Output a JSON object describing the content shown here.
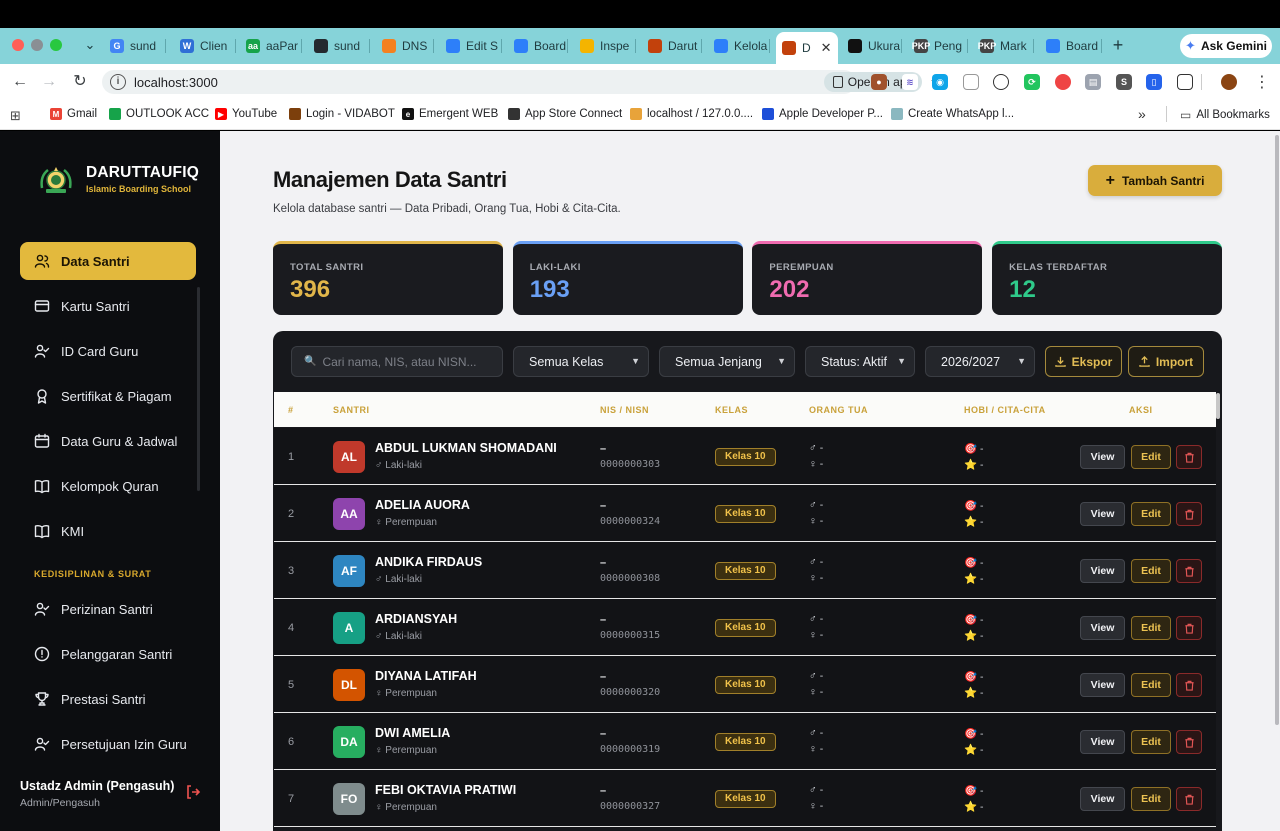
{
  "browser": {
    "tabs": [
      {
        "label": "sund",
        "fav": "G",
        "color": "#4285f4"
      },
      {
        "label": "Clien",
        "fav": "W",
        "color": "#2f6fd6"
      },
      {
        "label": "aaPar",
        "fav": "aa",
        "color": "#16a34a"
      },
      {
        "label": "sund",
        "fav": "",
        "color": "#24292f"
      },
      {
        "label": "DNS",
        "fav": "",
        "color": "#f48120"
      },
      {
        "label": "Edit S",
        "fav": "",
        "color": "#2d7ff9"
      },
      {
        "label": "Board",
        "fav": "",
        "color": "#2d7ff9"
      },
      {
        "label": "Inspe",
        "fav": "",
        "color": "#f4b400"
      },
      {
        "label": "Darut",
        "fav": "",
        "color": "#c2410c"
      },
      {
        "label": "Kelola",
        "fav": "",
        "color": "#2d7ff9"
      },
      {
        "label": "D",
        "fav": "",
        "color": "#c2410c",
        "active": true
      },
      {
        "label": "Ukura",
        "fav": "",
        "color": "#111111"
      },
      {
        "label": "Peng",
        "fav": "PKP",
        "color": "#444444"
      },
      {
        "label": "Mark",
        "fav": "PKP",
        "color": "#444444"
      },
      {
        "label": "Board",
        "fav": "",
        "color": "#2d7ff9"
      }
    ],
    "gemini": "Ask Gemini",
    "url": "localhost:3000",
    "open_in_app": "Open in app",
    "bookmarks": [
      {
        "label": "Gmail",
        "color": "#ea4335",
        "fav": "M"
      },
      {
        "label": "OUTLOOK ACC",
        "color": "#16a34a",
        "fav": ""
      },
      {
        "label": "YouTube",
        "color": "#ff0000",
        "fav": "▶"
      },
      {
        "label": "Login - VIDABOT",
        "color": "#7c3f0c",
        "fav": ""
      },
      {
        "label": "Emergent WEB",
        "color": "#111111",
        "fav": "e"
      },
      {
        "label": "App Store Connect",
        "color": "#333333",
        "fav": ""
      },
      {
        "label": "localhost / 127.0.0....",
        "color": "#e8a33a",
        "fav": ""
      },
      {
        "label": "Apple Developer P...",
        "color": "#1d4ed8",
        "fav": ""
      },
      {
        "label": "Create WhatsApp l...",
        "color": "#8bb8c0",
        "fav": ""
      }
    ],
    "all_bookmarks": "All Bookmarks"
  },
  "sidebar": {
    "brand": "DARUTTAUFIQ",
    "tagline": "Islamic Boarding School",
    "items": [
      {
        "label": "Data Santri",
        "icon": "users-icon"
      },
      {
        "label": "Kartu Santri",
        "icon": "card-icon"
      },
      {
        "label": "ID Card Guru",
        "icon": "user-check-icon"
      },
      {
        "label": "Sertifikat & Piagam",
        "icon": "award-icon"
      },
      {
        "label": "Data Guru & Jadwal",
        "icon": "calendar-icon"
      },
      {
        "label": "Kelompok Quran",
        "icon": "book-icon"
      },
      {
        "label": "KMI",
        "icon": "book-icon"
      }
    ],
    "section_label": "KEDISIPLINAN & SURAT",
    "section_items": [
      {
        "label": "Perizinan Santri",
        "icon": "user-check-icon"
      },
      {
        "label": "Pelanggaran Santri",
        "icon": "alert-circle-icon"
      },
      {
        "label": "Prestasi Santri",
        "icon": "trophy-icon"
      },
      {
        "label": "Persetujuan Izin Guru",
        "icon": "user-check-icon"
      }
    ],
    "user": {
      "name": "Ustadz Admin (Pengasuh)",
      "role": "Admin/Pengasuh"
    }
  },
  "page": {
    "title": "Manajemen Data Santri",
    "subtitle": "Kelola database santri — Data Pribadi, Orang Tua, Hobi & Cita-Cita.",
    "add_button": "Tambah Santri"
  },
  "stats": [
    {
      "label": "TOTAL SANTRI",
      "value": "396",
      "color": "#e1b64a"
    },
    {
      "label": "LAKI-LAKI",
      "value": "193",
      "color": "#6aa0f5"
    },
    {
      "label": "PEREMPUAN",
      "value": "202",
      "color": "#f06bb0"
    },
    {
      "label": "KELAS TERDAFTAR",
      "value": "12",
      "color": "#2fca8a"
    }
  ],
  "filters": {
    "search_placeholder": "Cari nama, NIS, atau NISN...",
    "kelas": "Semua Kelas",
    "jenjang": "Semua Jenjang",
    "status": "Status: Aktif",
    "tahun": "2026/2027",
    "export": "Ekspor",
    "import": "Import"
  },
  "table": {
    "columns": [
      "#",
      "SANTRI",
      "NIS / NISN",
      "KELAS",
      "ORANG TUA",
      "HOBI / CITA-CITA",
      "AKSI"
    ],
    "rows": [
      {
        "no": "1",
        "initials": "AL",
        "color": "#c0392b",
        "name": "ABDUL LUKMAN SHOMADANI",
        "gender": "♂ Laki-laki",
        "nis": "–",
        "nisn": "0000000303",
        "kelas": "Kelas 10",
        "ayah": "♂ -",
        "ibu": "♀ -",
        "hobi": "🎯 -",
        "cita": "⭐ -"
      },
      {
        "no": "2",
        "initials": "AA",
        "color": "#8e44ad",
        "name": "ADELIA AUORA",
        "gender": "♀ Perempuan",
        "nis": "–",
        "nisn": "0000000324",
        "kelas": "Kelas 10",
        "ayah": "♂ -",
        "ibu": "♀ -",
        "hobi": "🎯 -",
        "cita": "⭐ -"
      },
      {
        "no": "3",
        "initials": "AF",
        "color": "#2e86c1",
        "name": "ANDIKA FIRDAUS",
        "gender": "♂ Laki-laki",
        "nis": "–",
        "nisn": "0000000308",
        "kelas": "Kelas 10",
        "ayah": "♂ -",
        "ibu": "♀ -",
        "hobi": "🎯 -",
        "cita": "⭐ -"
      },
      {
        "no": "4",
        "initials": "A",
        "color": "#16a085",
        "name": "ARDIANSYAH",
        "gender": "♂ Laki-laki",
        "nis": "–",
        "nisn": "0000000315",
        "kelas": "Kelas 10",
        "ayah": "♂ -",
        "ibu": "♀ -",
        "hobi": "🎯 -",
        "cita": "⭐ -"
      },
      {
        "no": "5",
        "initials": "DL",
        "color": "#d35400",
        "name": "DIYANA LATIFAH",
        "gender": "♀ Perempuan",
        "nis": "–",
        "nisn": "0000000320",
        "kelas": "Kelas 10",
        "ayah": "♂ -",
        "ibu": "♀ -",
        "hobi": "🎯 -",
        "cita": "⭐ -"
      },
      {
        "no": "6",
        "initials": "DA",
        "color": "#27ae60",
        "name": "DWI AMELIA",
        "gender": "♀ Perempuan",
        "nis": "–",
        "nisn": "0000000319",
        "kelas": "Kelas 10",
        "ayah": "♂ -",
        "ibu": "♀ -",
        "hobi": "🎯 -",
        "cita": "⭐ -"
      },
      {
        "no": "7",
        "initials": "FO",
        "color": "#7f8c8d",
        "name": "FEBI OKTAVIA PRATIWI",
        "gender": "♀ Perempuan",
        "nis": "–",
        "nisn": "0000000327",
        "kelas": "Kelas 10",
        "ayah": "♂ -",
        "ibu": "♀ -",
        "hobi": "🎯 -",
        "cita": "⭐ -"
      }
    ],
    "view_label": "View",
    "edit_label": "Edit"
  }
}
